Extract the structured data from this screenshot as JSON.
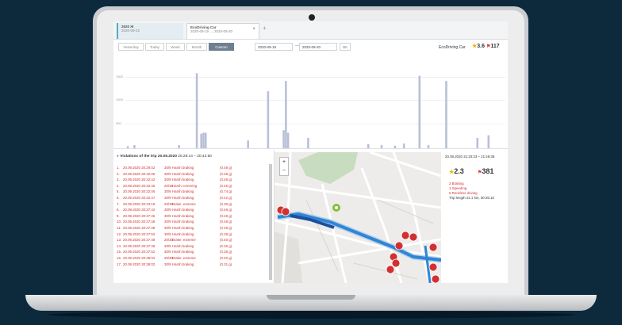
{
  "tabs": [
    {
      "title": "2620 Ж",
      "subtitle": "2020-09-22"
    },
    {
      "title": "EcoDriving Car",
      "subtitle": "2020-09-19 → 2020-09-20",
      "close": "×"
    }
  ],
  "tab_add": "+",
  "toolbar": {
    "buttons": [
      "Yesterday",
      "Today",
      "Week",
      "Month",
      "Custom"
    ],
    "active": "Custom",
    "date_from": "2020-09-19",
    "date_sep": "—",
    "date_to": "2020-09-20",
    "ok_label": "OK",
    "car_name": "EcoDriving Car",
    "rating": "3.6",
    "violations_count": "117"
  },
  "chart_data": {
    "type": "bar",
    "yticks": [
      "1500",
      "1000",
      "500"
    ],
    "ylim": [
      0,
      1700
    ],
    "values": [
      0,
      40,
      0,
      0,
      60,
      0,
      0,
      0,
      0,
      0,
      0,
      0,
      0,
      0,
      0,
      0,
      0,
      0,
      0,
      0,
      0,
      0,
      0,
      0,
      60,
      0,
      0,
      0,
      0,
      0,
      0,
      0,
      1450,
      0,
      280,
      300,
      300,
      0,
      0,
      0,
      0,
      0,
      0,
      0,
      0,
      0,
      0,
      0,
      0,
      0,
      0,
      0,
      0,
      0,
      0,
      150,
      0,
      0,
      0,
      0,
      0,
      0,
      0,
      0,
      1100,
      0,
      0,
      0,
      0,
      0,
      0,
      350,
      1300,
      300,
      0,
      0,
      0,
      0,
      0,
      0,
      0,
      0,
      200,
      0,
      0,
      0,
      0,
      0,
      0,
      0,
      0,
      0,
      0,
      0,
      0,
      0,
      0,
      0,
      0,
      0,
      0,
      0,
      0,
      0,
      0,
      0,
      0,
      0,
      0,
      80,
      0,
      0,
      0,
      0,
      0,
      60,
      0,
      0,
      0,
      0,
      0,
      50,
      0,
      0,
      0,
      90,
      0,
      0,
      0,
      0,
      0,
      0,
      1400,
      0,
      0,
      0,
      60,
      0,
      0,
      0,
      0,
      0,
      0,
      0,
      1300,
      0,
      0,
      0,
      0,
      0,
      0,
      0,
      0,
      0,
      0,
      0,
      0,
      0,
      200,
      0,
      0,
      0,
      0,
      250,
      0,
      0,
      0,
      0,
      0,
      0,
      0
    ]
  },
  "violations": {
    "header_label": "Violations of the trip",
    "header_date": "20.09.2020",
    "header_time": "20:28:14 – 20:42:50",
    "rows": [
      {
        "n": "1.",
        "date": "20.09.2020 20:29:02",
        "speed": "30/9",
        "type": "Harsh braking",
        "val": "(0.48 g)"
      },
      {
        "n": "2.",
        "date": "20.09.2020 20:32:06",
        "speed": "30/9",
        "type": "Harsh braking",
        "val": "(0.48 g)"
      },
      {
        "n": "3.",
        "date": "20.09.2020 20:32:42",
        "speed": "30/9",
        "type": "Harsh braking",
        "val": "(0.48 g)"
      },
      {
        "n": "4.",
        "date": "20.09.2020 20:32:46",
        "speed": "20/30",
        "type": "Harsh cornering",
        "val": "(0.45 g)"
      },
      {
        "n": "5.",
        "date": "20.09.2020 20:32:46",
        "speed": "30/9",
        "type": "Harsh braking",
        "val": "(0.74 g)"
      },
      {
        "n": "6.",
        "date": "20.09.2020 20:32:47",
        "speed": "30/9",
        "type": "Harsh braking",
        "val": "(0.42 g)"
      },
      {
        "n": "7.",
        "date": "20.09.2020 20:33:18",
        "speed": "20/30",
        "type": "Brake: extreme",
        "val": "(0.39 g)"
      },
      {
        "n": "8.",
        "date": "20.09.2020 20:37:42",
        "speed": "30/9",
        "type": "Harsh braking",
        "val": "(0.48 g)"
      },
      {
        "n": "9.",
        "date": "20.09.2020 20:37:46",
        "speed": "30/9",
        "type": "Harsh braking",
        "val": "(0.48 g)"
      },
      {
        "n": "10.",
        "date": "20.09.2020 20:37:46",
        "speed": "30/9",
        "type": "Harsh braking",
        "val": "(0.48 g)"
      },
      {
        "n": "11.",
        "date": "20.09.2020 20:37:48",
        "speed": "30/9",
        "type": "Harsh braking",
        "val": "(0.48 g)"
      },
      {
        "n": "12.",
        "date": "20.09.2020 20:37:52",
        "speed": "30/9",
        "type": "Harsh braking",
        "val": "(0.28 g)"
      },
      {
        "n": "13.",
        "date": "20.09.2020 20:37:48",
        "speed": "20/30",
        "type": "Brake: extreme",
        "val": "(0.40 g)"
      },
      {
        "n": "14.",
        "date": "20.09.2020 20:37:48",
        "speed": "30/9",
        "type": "Harsh braking",
        "val": "(0.26 g)"
      },
      {
        "n": "15.",
        "date": "20.09.2020 20:37:52",
        "speed": "30/9",
        "type": "Harsh braking",
        "val": "(0.28 g)"
      },
      {
        "n": "16.",
        "date": "20.09.2020 20:38:02",
        "speed": "20/30",
        "type": "Brake: extreme",
        "val": "(0.40 g)"
      },
      {
        "n": "17.",
        "date": "20.09.2020 20:38:02",
        "speed": "30/9",
        "type": "Harsh braking",
        "val": "(0.31 g)"
      }
    ]
  },
  "map": {
    "zoom_in": "+",
    "zoom_out": "−"
  },
  "info": {
    "datetime": "20.09.2020 21:20:23 – 21:46:38",
    "rating": "2.3",
    "count": "381",
    "legend": [
      {
        "text": "2  Braking",
        "color": "#d23030"
      },
      {
        "text": "1  Speeding",
        "color": "#d23030"
      },
      {
        "text": "6  Reckless driving",
        "color": "#d23030"
      },
      {
        "text": "Trip length 22.1 km, 00:25:10",
        "color": "#333333"
      }
    ]
  },
  "colors": {
    "accent": "#6e8090",
    "bar": "#b7bfd8",
    "route": "#2f86d6",
    "violation": "#d23030"
  }
}
